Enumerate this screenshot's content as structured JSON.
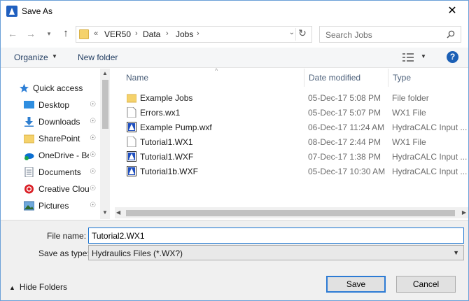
{
  "window": {
    "title": "Save As",
    "close_glyph": "✕"
  },
  "nav": {
    "back_glyph": "←",
    "forward_glyph": "→",
    "recent_glyph": "▾",
    "up_glyph": "↑"
  },
  "address": {
    "overflow": "«",
    "crumbs": [
      "VER50",
      "Data",
      "Jobs"
    ],
    "separator": "›",
    "dropdown_glyph": "⌄",
    "refresh_glyph": "↻"
  },
  "search": {
    "placeholder": "Search Jobs"
  },
  "toolbar": {
    "organize_label": "Organize",
    "organize_caret": "▼",
    "new_folder_label": "New folder",
    "view_caret": "▼",
    "help_label": "?"
  },
  "navpane": {
    "items": [
      {
        "label": "Quick access",
        "icon": "star-icon",
        "pinned": false
      },
      {
        "label": "Desktop",
        "icon": "desktop-icon",
        "pinned": true
      },
      {
        "label": "Downloads",
        "icon": "download-icon",
        "pinned": true
      },
      {
        "label": "SharePoint",
        "icon": "folder-icon",
        "pinned": true
      },
      {
        "label": "OneDrive - Be",
        "icon": "onedrive-icon",
        "pinned": true
      },
      {
        "label": "Documents",
        "icon": "documents-icon",
        "pinned": true
      },
      {
        "label": "Creative Clou",
        "icon": "creative-cloud-icon",
        "pinned": true
      },
      {
        "label": "Pictures",
        "icon": "pictures-icon",
        "pinned": true
      }
    ],
    "pin_glyph": "📌",
    "scroll_up": "▲",
    "scroll_down": "▼"
  },
  "filelist": {
    "columns": {
      "name": "Name",
      "date": "Date modified",
      "type": "Type"
    },
    "sort_caret": "^",
    "rows": [
      {
        "name": "Example Jobs",
        "date": "05-Dec-17 5:08 PM",
        "type": "File folder",
        "icon": "folder-icon"
      },
      {
        "name": "Errors.wx1",
        "date": "05-Dec-17 5:07 PM",
        "type": "WX1 File",
        "icon": "file-icon"
      },
      {
        "name": "Example Pump.wxf",
        "date": "06-Dec-17 11:24 AM",
        "type": "HydraCALC Input ...",
        "icon": "hydracalc-icon"
      },
      {
        "name": "Tutorial1.WX1",
        "date": "08-Dec-17 2:44 PM",
        "type": "WX1 File",
        "icon": "file-icon"
      },
      {
        "name": "Tutorial1.WXF",
        "date": "07-Dec-17 1:38 PM",
        "type": "HydraCALC Input ...",
        "icon": "hydracalc-icon"
      },
      {
        "name": "Tutorial1b.WXF",
        "date": "05-Dec-17 10:30 AM",
        "type": "HydraCALC Input ...",
        "icon": "hydracalc-icon"
      }
    ],
    "hscroll_left": "◀",
    "hscroll_right": "▶"
  },
  "form": {
    "file_name_label": "File name:",
    "file_name_value": "Tutorial2.WX1",
    "save_type_label": "Save as type:",
    "save_type_value": "Hydraulics Files (*.WX?)",
    "select_caret": "▼"
  },
  "footer": {
    "hide_folders_caret": "▲",
    "hide_folders_label": "Hide Folders",
    "save_label": "Save",
    "cancel_label": "Cancel"
  },
  "colors": {
    "accent": "#1a73d0",
    "folder": "#f5d26b",
    "help": "#1b5fb5"
  }
}
